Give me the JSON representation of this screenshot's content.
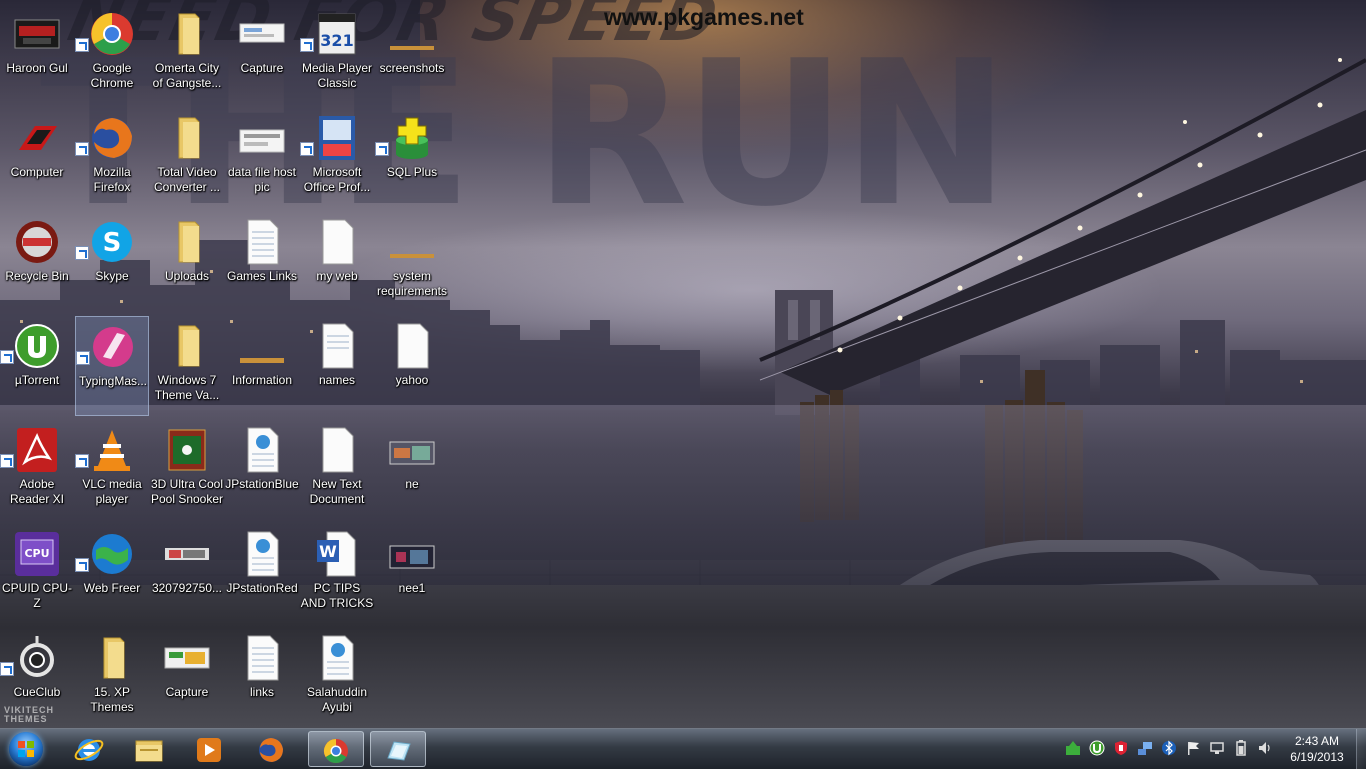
{
  "wallpaper": {
    "title_top": "NEED FOR SPEED",
    "title_main": "THE RUN",
    "site": "www.pkgames.net",
    "brand_line1": "VIKITECH",
    "brand_line2": "THEMES"
  },
  "desktop_icons": {
    "col1": [
      {
        "label": "Haroon Gul",
        "icon": "wallpaper-thumb-icon"
      },
      {
        "label": "Computer",
        "icon": "computer-icon"
      },
      {
        "label": "Recycle Bin",
        "icon": "recycle-bin-icon"
      },
      {
        "label": "µTorrent",
        "icon": "utorrent-icon"
      },
      {
        "label": "Adobe Reader XI",
        "icon": "adobe-reader-icon"
      },
      {
        "label": "CPUID CPU-Z",
        "icon": "cpuz-icon"
      },
      {
        "label": "CueClub",
        "icon": "cueclub-icon"
      }
    ],
    "col2": [
      {
        "label": "Google Chrome",
        "icon": "chrome-icon"
      },
      {
        "label": "Mozilla Firefox",
        "icon": "firefox-icon"
      },
      {
        "label": "Skype",
        "icon": "skype-icon"
      },
      {
        "label": "TypingMas...",
        "icon": "typingmaster-icon"
      },
      {
        "label": "VLC media player",
        "icon": "vlc-icon"
      },
      {
        "label": "Web Freer",
        "icon": "webfreer-icon"
      },
      {
        "label": "15. XP Themes",
        "icon": "folder-icon"
      }
    ],
    "col3": [
      {
        "label": "Omerta City of Gangste...",
        "icon": "folder-icon"
      },
      {
        "label": "Total Video Converter ...",
        "icon": "folder-icon"
      },
      {
        "label": "Uploads",
        "icon": "folder-icon"
      },
      {
        "label": "Windows 7 Theme Va...",
        "icon": "folder-icon"
      },
      {
        "label": "3D Ultra Cool Pool Snooker",
        "icon": "pool-snooker-icon"
      },
      {
        "label": "320792750...",
        "icon": "image-file-icon"
      },
      {
        "label": "Capture",
        "icon": "image-file-icon"
      }
    ],
    "col4": [
      {
        "label": "Capture",
        "icon": "image-file-icon"
      },
      {
        "label": "data file host pic",
        "icon": "image-file-icon"
      },
      {
        "label": "Games Links",
        "icon": "text-file-icon"
      },
      {
        "label": "Information",
        "icon": "image-file-icon"
      },
      {
        "label": "JPstationBlue",
        "icon": "html-file-icon"
      },
      {
        "label": "JPstationRed",
        "icon": "html-file-icon"
      },
      {
        "label": "links",
        "icon": "text-file-icon"
      }
    ],
    "col5": [
      {
        "label": "Media Player Classic",
        "icon": "mpc-icon"
      },
      {
        "label": "Microsoft Office Prof...",
        "icon": "office-icon"
      },
      {
        "label": "my web",
        "icon": "text-file-icon"
      },
      {
        "label": "names",
        "icon": "text-file-icon"
      },
      {
        "label": "New Text Document",
        "icon": "text-file-icon"
      },
      {
        "label": "PC TIPS AND TRICKS",
        "icon": "word-doc-icon"
      },
      {
        "label": "Salahuddin Ayubi",
        "icon": "html-file-icon"
      }
    ],
    "col6": [
      {
        "label": "screenshots",
        "icon": "image-file-icon"
      },
      {
        "label": "SQL Plus",
        "icon": "sqlplus-icon"
      },
      {
        "label": "system requirements",
        "icon": "image-file-icon"
      },
      {
        "label": "yahoo",
        "icon": "text-file-icon"
      },
      {
        "label": "ne",
        "icon": "image-file-icon"
      },
      {
        "label": "nee1",
        "icon": "image-file-icon"
      }
    ]
  },
  "taskbar": {
    "pinned": [
      {
        "name": "internet-explorer",
        "icon": "internet-explorer-icon"
      },
      {
        "name": "windows-explorer",
        "icon": "folder-icon"
      },
      {
        "name": "media-player",
        "icon": "media-player-icon"
      },
      {
        "name": "firefox",
        "icon": "firefox-icon"
      },
      {
        "name": "chrome",
        "icon": "chrome-icon"
      },
      {
        "name": "paint-window",
        "icon": "window-icon"
      }
    ],
    "clock": {
      "time": "2:43 AM",
      "date": "6/19/2013"
    }
  },
  "colors": {
    "taskbar_top": "#5f6978",
    "taskbar_bottom": "#191e26",
    "folder_yellow": "#e8c766",
    "chrome_red": "#db3a2f",
    "chrome_yellow": "#f6c22b",
    "chrome_green": "#2d9f4a",
    "chrome_blue": "#3d7fe0"
  }
}
